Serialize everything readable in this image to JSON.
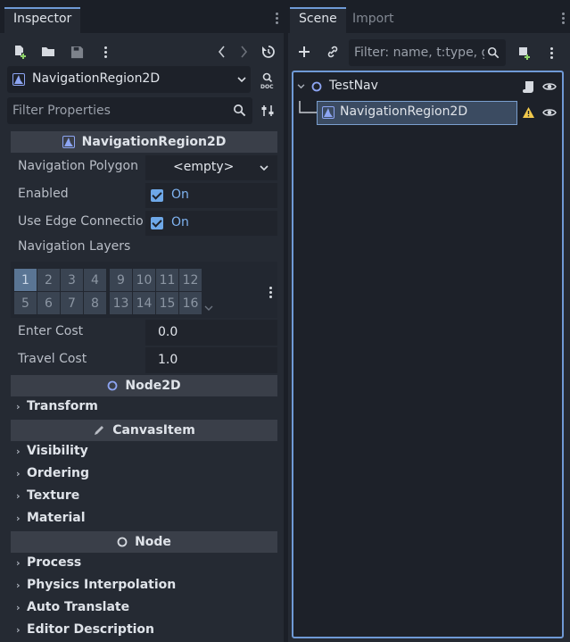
{
  "inspector": {
    "tab": "Inspector",
    "node_selector": {
      "label": "NavigationRegion2D"
    },
    "filter": {
      "placeholder": "Filter Properties"
    },
    "sections": [
      {
        "label": "NavigationRegion2D",
        "icon": "navigation-region-icon"
      },
      {
        "label": "Node2D",
        "icon": "node2d-circle-icon"
      },
      {
        "label": "CanvasItem",
        "icon": "pencil-icon"
      },
      {
        "label": "Node",
        "icon": "node-circle-icon"
      }
    ],
    "props": {
      "navigation_polygon": {
        "label": "Navigation Polygon",
        "value": "<empty>"
      },
      "enabled": {
        "label": "Enabled",
        "value": "On"
      },
      "edge_connections": {
        "label": "Use Edge Connectio",
        "value": "On"
      },
      "navigation_layers": {
        "label": "Navigation Layers"
      },
      "enter_cost": {
        "label": "Enter Cost",
        "value": "0.0"
      },
      "travel_cost": {
        "label": "Travel Cost",
        "value": "1.0"
      }
    },
    "layers": {
      "row1": [
        "1",
        "2",
        "3",
        "4",
        "9",
        "10",
        "11",
        "12"
      ],
      "row2": [
        "5",
        "6",
        "7",
        "8",
        "13",
        "14",
        "15",
        "16"
      ],
      "active": [
        "1"
      ]
    },
    "groups": {
      "transform": "Transform",
      "visibility": "Visibility",
      "ordering": "Ordering",
      "texture": "Texture",
      "material": "Material",
      "process": "Process",
      "physics_interpolation": "Physics Interpolation",
      "auto_translate": "Auto Translate",
      "editor_description": "Editor Description"
    }
  },
  "scene": {
    "tabs": {
      "scene": "Scene",
      "import": "Import"
    },
    "filter": {
      "placeholder": "Filter: name, t:type, g:"
    },
    "tree": [
      {
        "label": "TestNav",
        "icon": "node2d-circle-icon"
      },
      {
        "label": "NavigationRegion2D",
        "icon": "navigation-region-icon",
        "warning": true,
        "selected": true
      }
    ]
  },
  "colors": {
    "accent": "#6f9ad6",
    "panel": "#252a33",
    "background": "#1b1f27",
    "check": "#6ea8e8",
    "warning": "#f2c94c",
    "node2d": "#8da5f3"
  }
}
